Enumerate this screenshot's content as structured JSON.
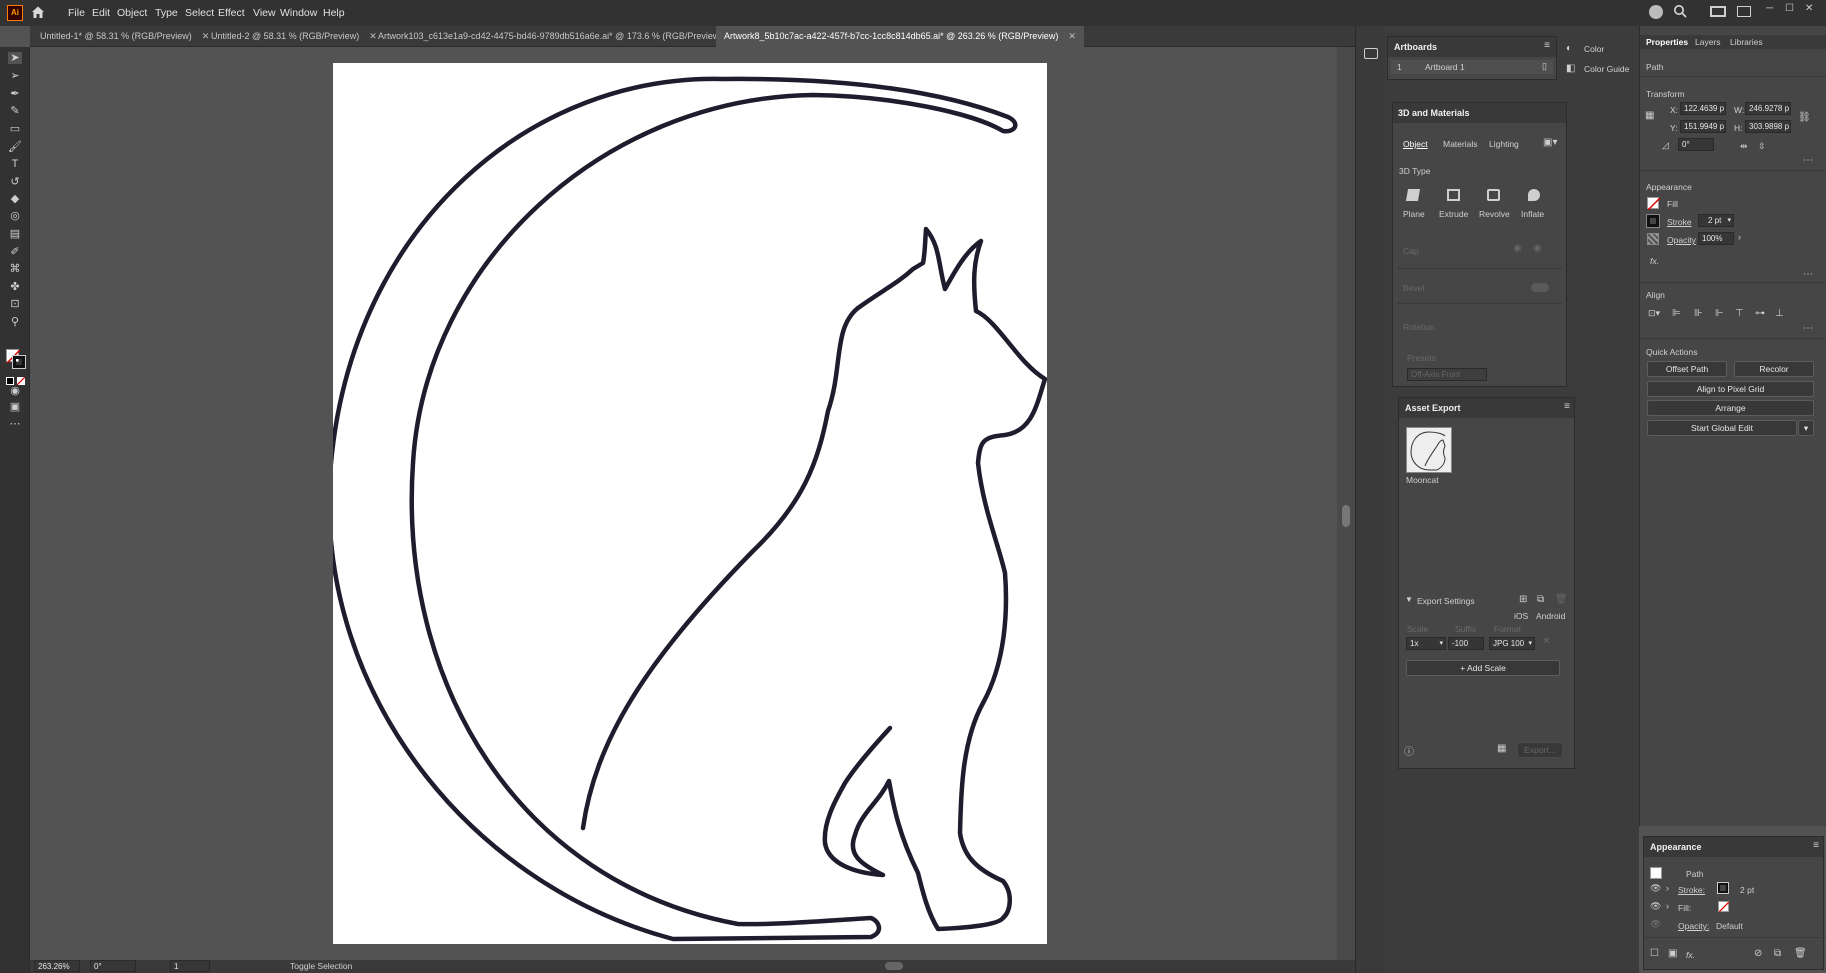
{
  "menu": [
    "File",
    "Edit",
    "Object",
    "Type",
    "Select",
    "Effect",
    "View",
    "Window",
    "Help"
  ],
  "tabs": [
    {
      "label": "Untitled-1* @ 58.31 % (RGB/Preview)",
      "active": false
    },
    {
      "label": "Untitled-2 @ 58.31 % (RGB/Preview)",
      "active": false
    },
    {
      "label": "Artwork103_c613e1a9-cd42-4475-bd46-9789db516a6e.ai* @ 173.6 % (RGB/Preview)",
      "active": false
    },
    {
      "label": "Artwork8_5b10c7ac-a422-457f-b7cc-1cc8c814db65.ai* @ 263.26 % (RGB/Preview)",
      "active": true
    }
  ],
  "tab_close": "✕",
  "status": {
    "zoom": "263.26%",
    "angle": "0°",
    "artboard_num": "1",
    "toggle": "Toggle Selection"
  },
  "artboards_panel": {
    "title": "Artboards",
    "row_num": "1",
    "row_name": "Artboard 1"
  },
  "color_panel": {
    "color": "Color",
    "guide": "Color Guide"
  },
  "materials": {
    "title": "3D and Materials",
    "tabs": [
      "Object",
      "Materials",
      "Lighting"
    ],
    "type_label": "3D Type",
    "types": [
      "Plane",
      "Extrude",
      "Revolve",
      "Inflate"
    ],
    "cap": "Cap",
    "bevel": "Bevel",
    "rotation": "Rotation",
    "presets": "Presets",
    "preset_value": "Off-Axis Front"
  },
  "asset_export": {
    "title": "Asset Export",
    "asset_name": "Mooncat",
    "settings": "Export Settings",
    "ios": "iOS",
    "android": "Android",
    "col_scale": "Scale",
    "col_suffix": "Suffix",
    "col_format": "Format",
    "scale": "1x",
    "suffix": "-100",
    "format": "JPG 100",
    "add_scale": "Add Scale",
    "export": "Export..."
  },
  "properties": {
    "tabs": [
      "Properties",
      "Layers",
      "Libraries"
    ],
    "selection": "Path",
    "transform": "Transform",
    "x_label": "X:",
    "x": "122.4639 p",
    "y_label": "Y:",
    "y": "151.9949 p",
    "w_label": "W:",
    "w": "246.9278 p",
    "h_label": "H:",
    "h": "303.9898 p",
    "angle": "0°",
    "appearance": "Appearance",
    "fill": "Fill",
    "stroke": "Stroke",
    "stroke_value": "2 pt",
    "opacity": "Opacity",
    "opacity_value": "100%",
    "fx": "fx.",
    "align": "Align",
    "quick_actions": "Quick Actions",
    "offset_path": "Offset Path",
    "recolor": "Recolor",
    "align_pixel": "Align to Pixel Grid",
    "arrange": "Arrange",
    "global_edit": "Start Global Edit"
  },
  "appearance_panel": {
    "title": "Appearance",
    "item": "Path",
    "stroke": "Stroke:",
    "stroke_value": "2 pt",
    "fill": "Fill:",
    "opacity": "Opacity:",
    "opacity_value": "Default",
    "fx": "fx."
  },
  "colors": {
    "accent": "#ff3c00",
    "stroke": "#1d1d2e",
    "ui_dark": "#323232",
    "panel": "#464646"
  }
}
